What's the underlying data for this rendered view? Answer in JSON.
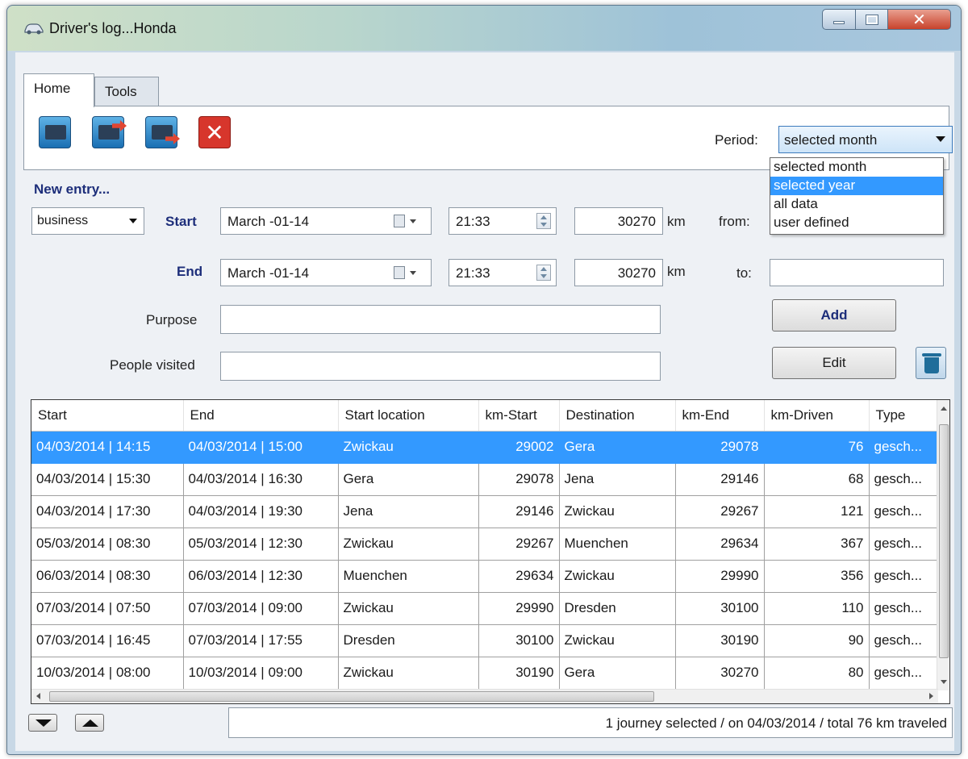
{
  "window": {
    "title": "Driver's log...Honda",
    "controls": {
      "close_glyph": "✕"
    }
  },
  "tabs": [
    {
      "label": "Home",
      "active": true
    },
    {
      "label": "Tools",
      "active": false
    }
  ],
  "toolbar": {
    "buttons": [
      "print-icon",
      "export-icon",
      "save-icon",
      "close-icon"
    ],
    "close_glyph": "✕"
  },
  "period": {
    "label": "Period:",
    "value": "selected month",
    "options": [
      "selected month",
      "selected year",
      "all data",
      "user defined"
    ],
    "highlighted": "selected year"
  },
  "entry": {
    "heading": "New entry...",
    "type_value": "business",
    "start": {
      "label": "Start",
      "date": "March   -01-14",
      "time": "21:33",
      "km": "30270",
      "km_unit": "km",
      "loc_label": "from:",
      "loc_value": ""
    },
    "end": {
      "label": "End",
      "date": "March   -01-14",
      "time": "21:33",
      "km": "30270",
      "km_unit": "km",
      "loc_label": "to:",
      "loc_value": ""
    },
    "purpose_label": "Purpose",
    "purpose_value": "",
    "people_label": "People visited",
    "people_value": "",
    "add_label": "Add",
    "edit_label": "Edit"
  },
  "grid": {
    "columns": [
      "Start",
      "End",
      "Start location",
      "km-Start",
      "Destination",
      "km-End",
      "km-Driven",
      "Type"
    ],
    "rows": [
      [
        "04/03/2014 | 14:15",
        "04/03/2014 | 15:00",
        "Zwickau",
        "29002",
        "Gera",
        "29078",
        "76",
        "gesch..."
      ],
      [
        "04/03/2014 | 15:30",
        "04/03/2014 | 16:30",
        "Gera",
        "29078",
        "Jena",
        "29146",
        "68",
        "gesch..."
      ],
      [
        "04/03/2014 | 17:30",
        "04/03/2014 | 19:30",
        "Jena",
        "29146",
        "Zwickau",
        "29267",
        "121",
        "gesch..."
      ],
      [
        "05/03/2014 | 08:30",
        "05/03/2014 | 12:30",
        "Zwickau",
        "29267",
        "Muenchen",
        "29634",
        "367",
        "gesch..."
      ],
      [
        "06/03/2014 | 08:30",
        "06/03/2014 | 12:30",
        "Muenchen",
        "29634",
        "Zwickau",
        "29990",
        "356",
        "gesch..."
      ],
      [
        "07/03/2014 | 07:50",
        "07/03/2014 | 09:00",
        "Zwickau",
        "29990",
        "Dresden",
        "30100",
        "110",
        "gesch..."
      ],
      [
        "07/03/2014 | 16:45",
        "07/03/2014 | 17:55",
        "Dresden",
        "30100",
        "Zwickau",
        "30190",
        "90",
        "gesch..."
      ],
      [
        "10/03/2014 | 08:00",
        "10/03/2014 | 09:00",
        "Zwickau",
        "30190",
        "Gera",
        "30270",
        "80",
        "gesch..."
      ]
    ],
    "selected_row": 0,
    "numeric_columns": [
      3,
      5,
      6
    ]
  },
  "status": {
    "text": "1 journey selected / on 04/03/2014 / total 76 km traveled"
  },
  "colors": {
    "selection": "#3399ff",
    "accent_label": "#1d2e7a",
    "close_button": "#d7362c"
  }
}
